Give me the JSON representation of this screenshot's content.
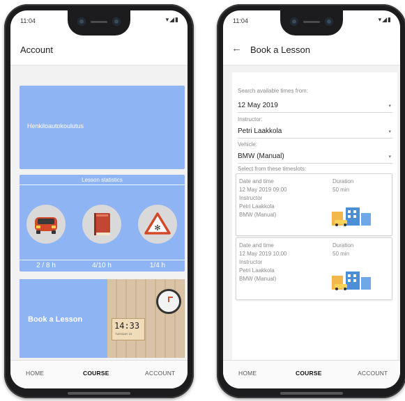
{
  "status_time": "11:04",
  "status_icons": "▾◢▮",
  "account": {
    "title": "Account",
    "school_name": "Henkiloautokoulutus",
    "stats_title": "Lesson statistics",
    "stats": [
      {
        "icon": "car-icon",
        "value": "2 / 8 h"
      },
      {
        "icon": "book-icon",
        "value": "4/10 h"
      },
      {
        "icon": "warning-sign-icon",
        "value": "1/4 h"
      }
    ],
    "book_label": "Book a Lesson",
    "clock_time": "14:33",
    "clock_day": "TUESDAY 23"
  },
  "book": {
    "back_icon": "←",
    "title": "Book a Lesson",
    "search_label": "Search available times from:",
    "date_value": "12 May 2019",
    "instructor_label": "Instructor:",
    "instructor_value": "Petri Laakkola",
    "vehicle_label": "Vehicle:",
    "vehicle_value": "BMW (Manual)",
    "timeslots_label": "Select from these timeslots:",
    "caret": "▾",
    "slots": [
      {
        "date_label": "Date and time",
        "date_value": "12 May 2019 09:00",
        "duration_label": "Duration",
        "duration_value": "50 min",
        "instructor_label": "Instructor",
        "instructor_value": "Petri Laakkola",
        "vehicle_value": "BMW (Manual)"
      },
      {
        "date_label": "Date and time",
        "date_value": "12 May 2019 10:00",
        "duration_label": "Duration",
        "duration_value": "50 min",
        "instructor_label": "Instructor",
        "instructor_value": "Petri Laakkola",
        "vehicle_value": "BMW (Manual)"
      }
    ]
  },
  "nav": {
    "home": "HOME",
    "course": "COURSE",
    "account": "ACCOUNT"
  },
  "colors": {
    "card_blue": "#8fb4f4",
    "car_red": "#d2492a",
    "book_red": "#c24633"
  }
}
